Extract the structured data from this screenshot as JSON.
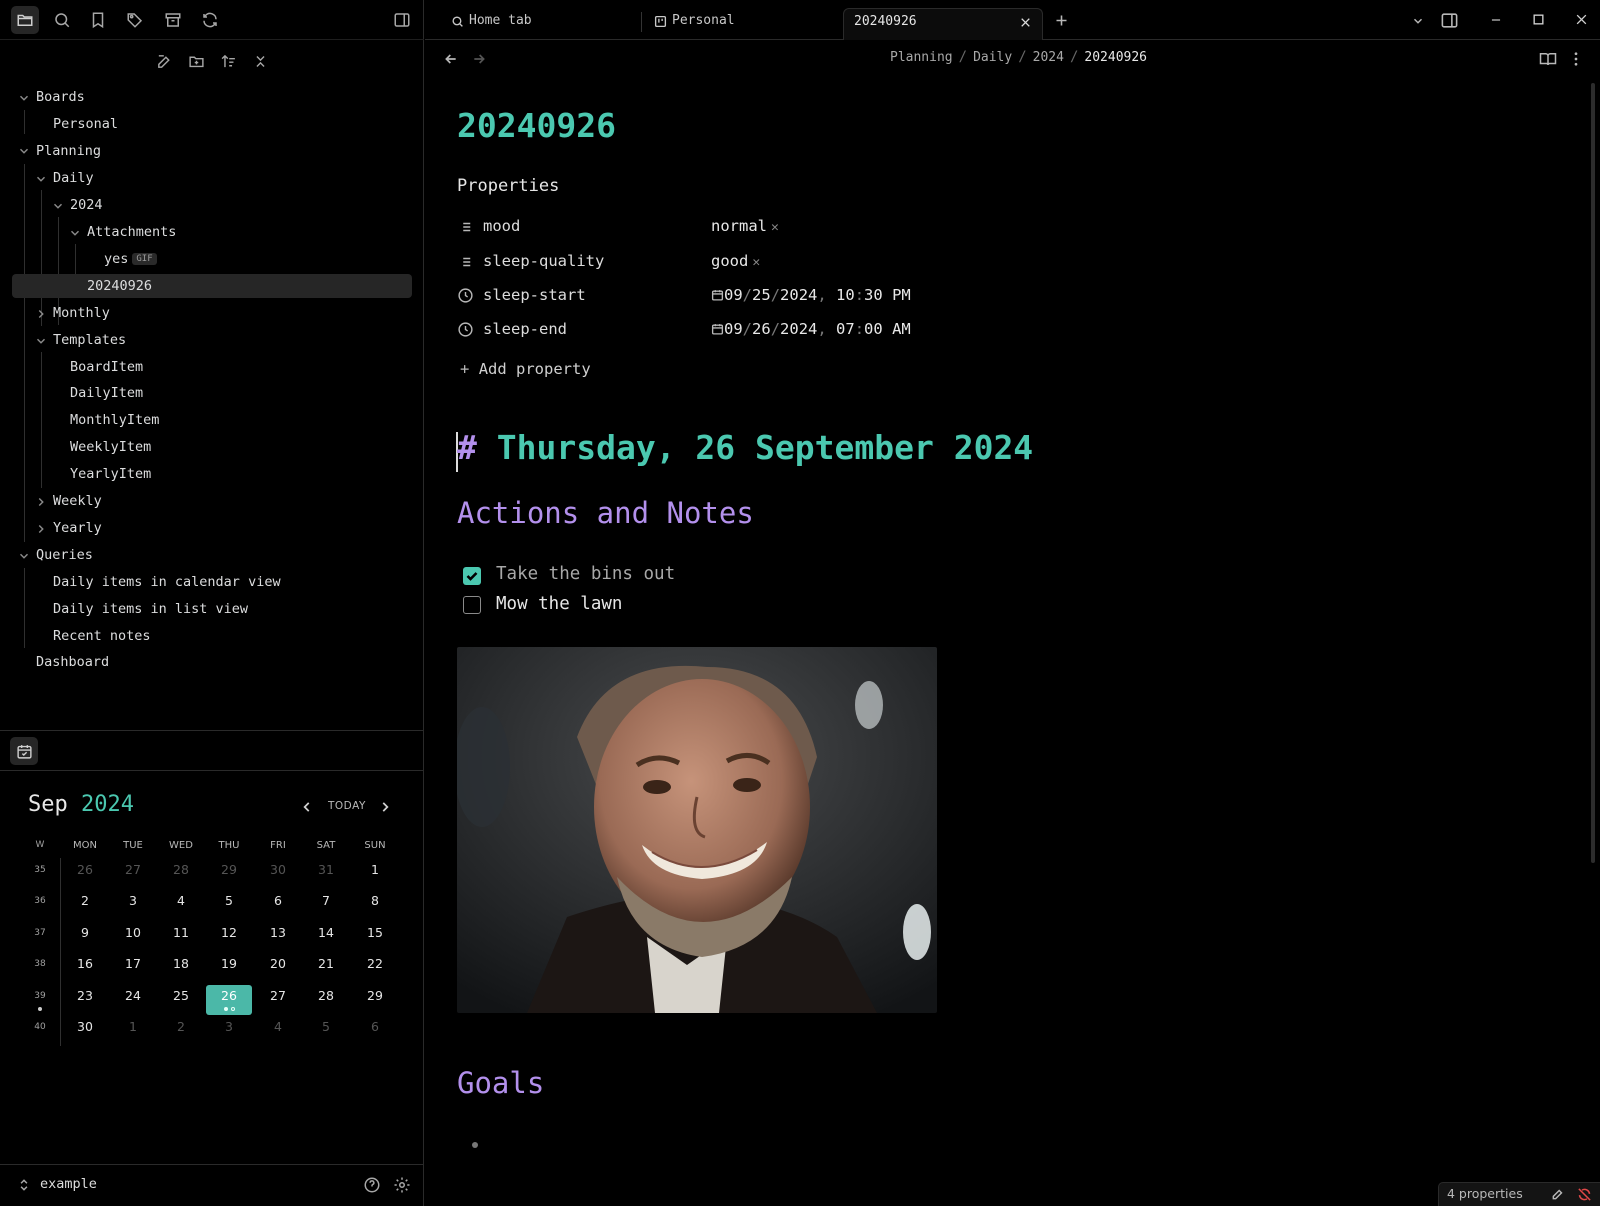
{
  "sidebar": {
    "tree": {
      "boards": "Boards",
      "personal": "Personal",
      "planning": "Planning",
      "daily": "Daily",
      "y2024": "2024",
      "attachments": "Attachments",
      "yes": "yes",
      "gif_badge": "GIF",
      "note": "20240926",
      "monthly": "Monthly",
      "templates": "Templates",
      "board_item": "BoardItem",
      "daily_item": "DailyItem",
      "monthly_item": "MonthlyItem",
      "weekly_item": "WeeklyItem",
      "yearly_item": "YearlyItem",
      "weekly": "Weekly",
      "yearly": "Yearly",
      "queries": "Queries",
      "q_calendar": "Daily items in calendar view",
      "q_list": "Daily items in list view",
      "recent": "Recent notes",
      "dashboard": "Dashboard"
    },
    "vault": "example"
  },
  "calendar": {
    "month": "Sep",
    "year": "2024",
    "today_label": "TODAY",
    "week_header": "W",
    "weekdays": [
      "MON",
      "TUE",
      "WED",
      "THU",
      "FRI",
      "SAT",
      "SUN"
    ],
    "weeks": [
      {
        "w": "35",
        "days": [
          "26",
          "27",
          "28",
          "29",
          "30",
          "31",
          "1"
        ]
      },
      {
        "w": "36",
        "days": [
          "2",
          "3",
          "4",
          "5",
          "6",
          "7",
          "8"
        ]
      },
      {
        "w": "37",
        "days": [
          "9",
          "10",
          "11",
          "12",
          "13",
          "14",
          "15"
        ]
      },
      {
        "w": "38",
        "days": [
          "16",
          "17",
          "18",
          "19",
          "20",
          "21",
          "22"
        ]
      },
      {
        "w": "39",
        "days": [
          "23",
          "24",
          "25",
          "26",
          "27",
          "28",
          "29"
        ]
      },
      {
        "w": "40",
        "days": [
          "30",
          "1",
          "2",
          "3",
          "4",
          "5",
          "6"
        ]
      }
    ]
  },
  "tabs": {
    "home": "Home tab",
    "personal": "Personal",
    "current": "20240926"
  },
  "breadcrumb": {
    "planning": "Planning",
    "daily": "Daily",
    "year": "2024",
    "note": "20240926",
    "sep": "/"
  },
  "note": {
    "title": "20240926",
    "properties_heading": "Properties",
    "properties": {
      "mood_key": "mood",
      "mood_val": "normal",
      "sleep_quality_key": "sleep-quality",
      "sleep_quality_val": "good",
      "sleep_start_key": "sleep-start",
      "sleep_start": {
        "mm": "09",
        "dd": "25",
        "yyyy": "2024",
        "hh": "10",
        "min": "30",
        "ampm": "PM"
      },
      "sleep_end_key": "sleep-end",
      "sleep_end": {
        "mm": "09",
        "dd": "26",
        "yyyy": "2024",
        "hh": "07",
        "min": "00",
        "ampm": "AM"
      },
      "add": "Add property"
    },
    "h1_hash": "#",
    "h1": "Thursday, 26 September 2024",
    "h2_actions": "Actions and Notes",
    "task1": "Take the bins out",
    "task2": "Mow the lawn",
    "h2_goals": "Goals"
  },
  "status": {
    "properties_count": "4 properties"
  }
}
